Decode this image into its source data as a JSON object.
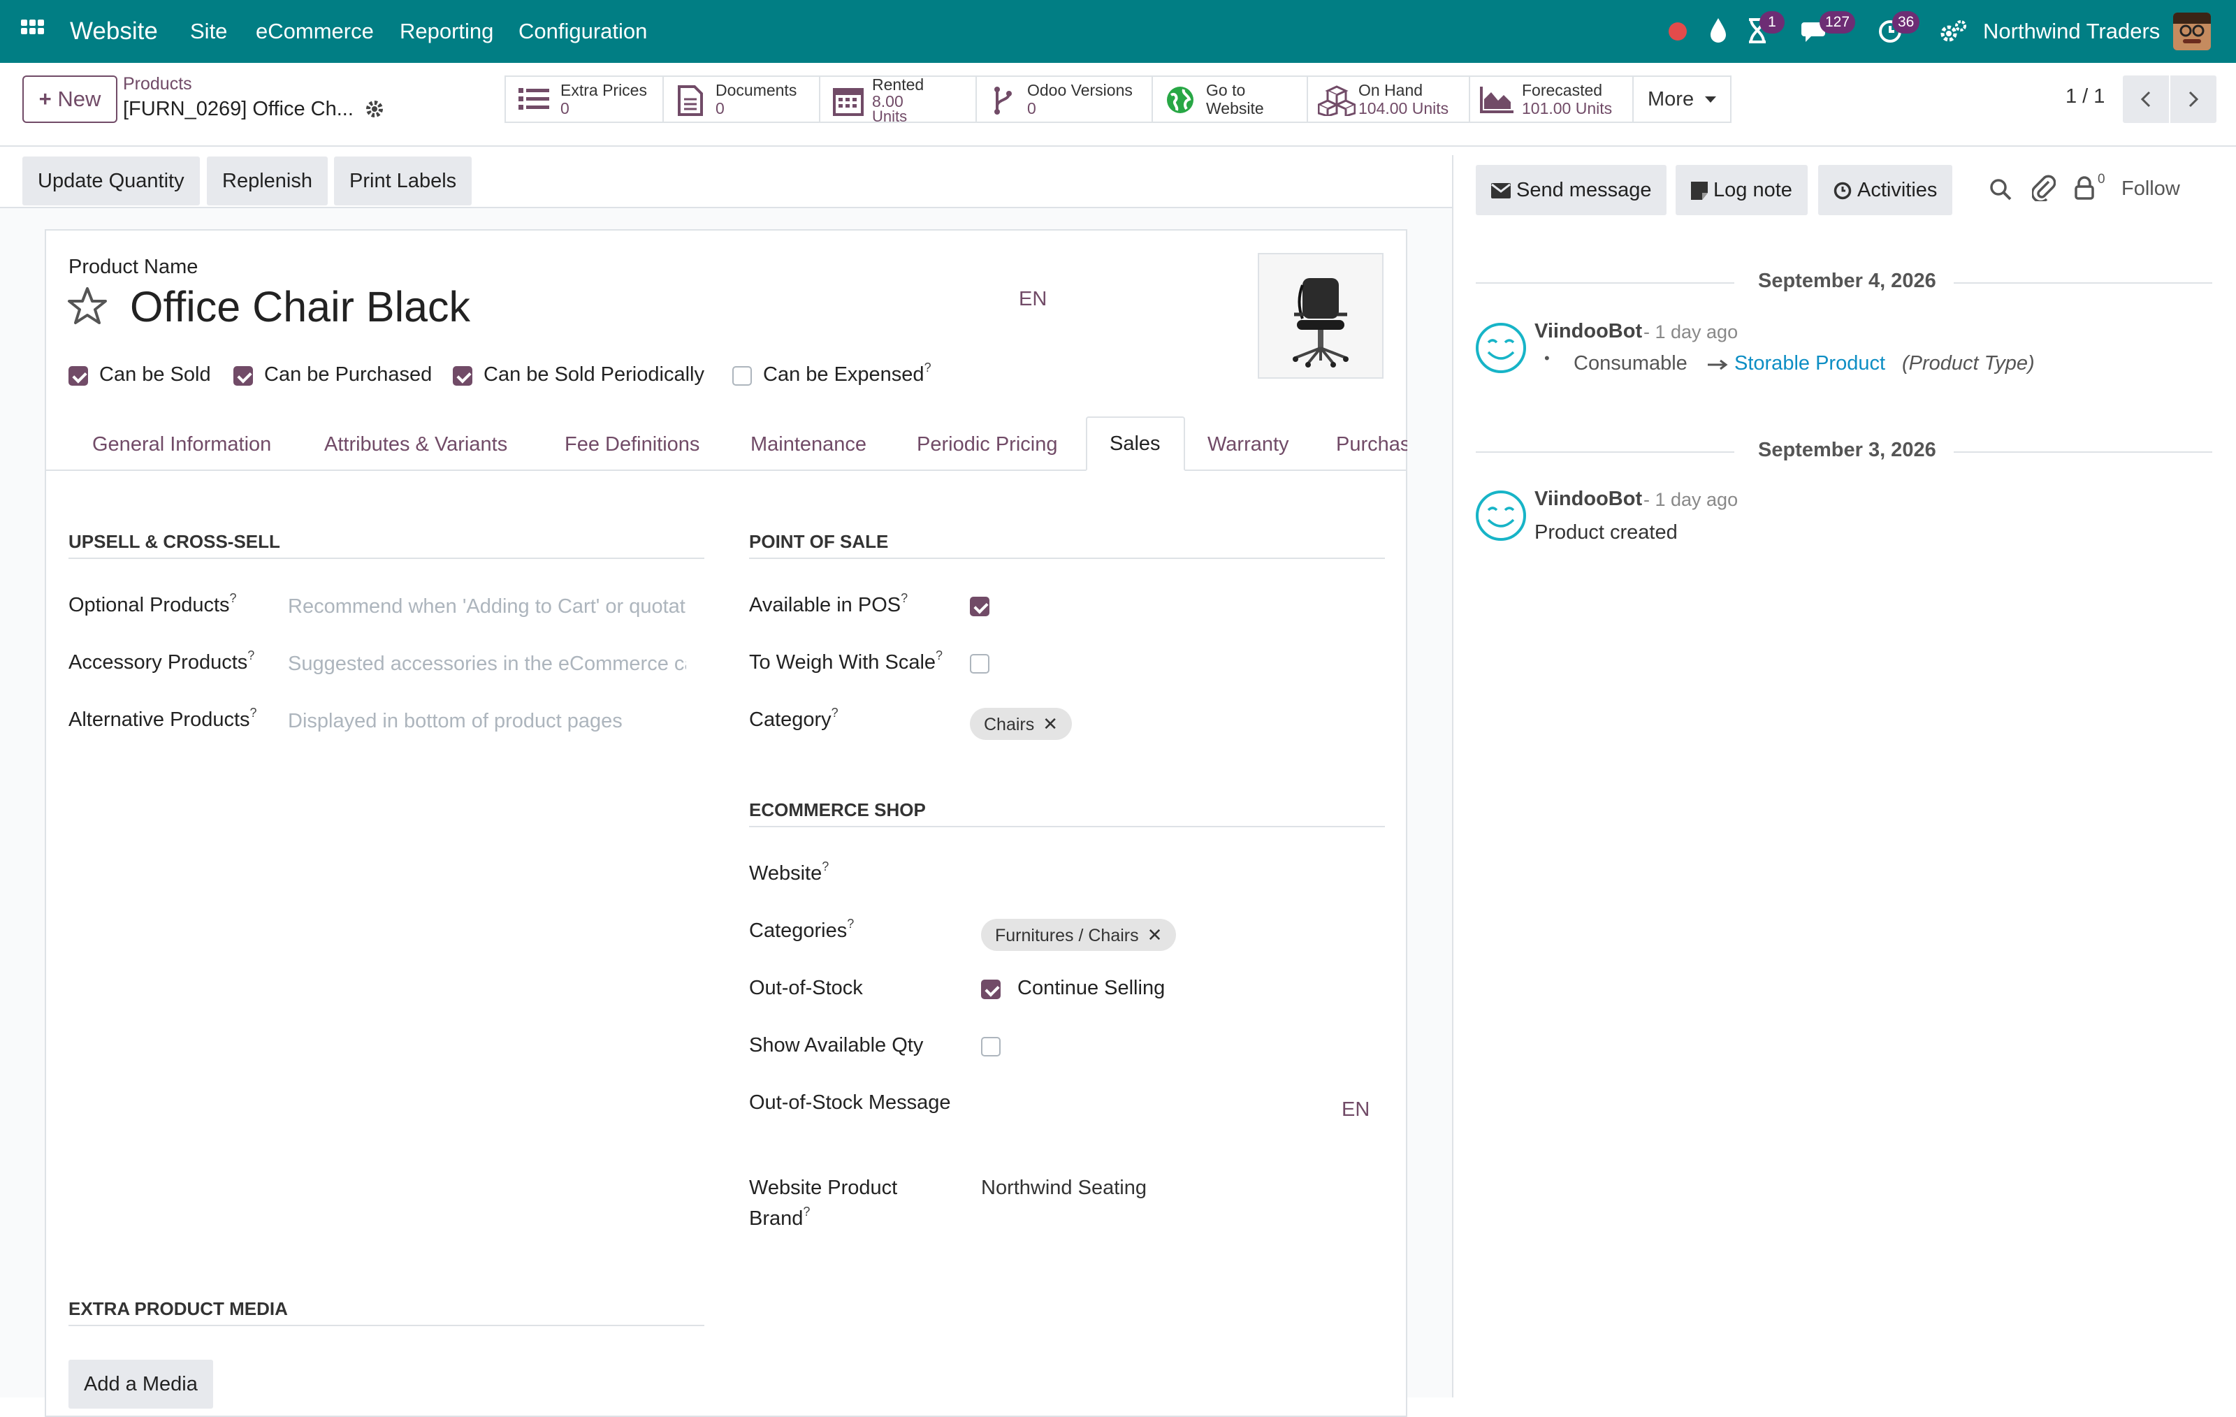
{
  "topbar": {
    "app_name": "Website",
    "menus": [
      "Site",
      "eCommerce",
      "Reporting",
      "Configuration"
    ],
    "activity_count": "1",
    "messages_count": "127",
    "clock_count": "36",
    "company": "Northwind Traders"
  },
  "control_panel": {
    "new_label": "New",
    "breadcrumb_parent": "Products",
    "breadcrumb_current": "[FURN_0269] Office Ch...",
    "pager": "1 / 1",
    "more_label": "More",
    "smart_buttons": [
      {
        "title": "Extra Prices",
        "value": "0"
      },
      {
        "title": "Documents",
        "value": "0"
      },
      {
        "title": "Rented",
        "value": "8.00",
        "value2": "Units"
      },
      {
        "title": "Odoo Versions",
        "value": "0"
      },
      {
        "title": "Go to",
        "value": "Website"
      },
      {
        "title": "On Hand",
        "value": "104.00 Units"
      },
      {
        "title": "Forecasted",
        "value": "101.00 Units"
      }
    ]
  },
  "statusbar": {
    "buttons": [
      "Update Quantity",
      "Replenish",
      "Print Labels"
    ]
  },
  "product": {
    "name_label": "Product Name",
    "name": "Office Chair Black",
    "lang": "EN",
    "flags": [
      {
        "label": "Can be Sold",
        "checked": true
      },
      {
        "label": "Can be Purchased",
        "checked": true
      },
      {
        "label": "Can be Sold Periodically",
        "checked": true
      },
      {
        "label": "Can be Expensed",
        "checked": false,
        "help": "?"
      }
    ]
  },
  "tabs": [
    "General Information",
    "Attributes & Variants",
    "Fee Definitions",
    "Maintenance",
    "Periodic Pricing",
    "Sales",
    "Warranty",
    "Purchas"
  ],
  "sales": {
    "upsell": {
      "title": "UPSELL & CROSS-SELL",
      "fields": [
        {
          "label": "Optional Products",
          "placeholder": "Recommend when 'Adding to Cart' or quotation"
        },
        {
          "label": "Accessory Products",
          "placeholder": "Suggested accessories in the eCommerce cart"
        },
        {
          "label": "Alternative Products",
          "placeholder": "Displayed in bottom of product pages"
        }
      ]
    },
    "pos": {
      "title": "POINT OF SALE",
      "available_label": "Available in POS",
      "available": true,
      "weigh_label": "To Weigh With Scale",
      "weigh": false,
      "category_label": "Category",
      "category_tag": "Chairs"
    },
    "ecommerce": {
      "title": "ECOMMERCE SHOP",
      "website_label": "Website",
      "categories_label": "Categories",
      "categories_tag": "Furnitures / Chairs",
      "oos_label": "Out-of-Stock",
      "continue_label": "Continue Selling",
      "continue": true,
      "show_qty_label": "Show Available Qty",
      "show_qty": false,
      "oos_msg_label": "Out-of-Stock Message",
      "oos_msg_lang": "EN",
      "brand_label_1": "Website Product",
      "brand_label_2": "Brand",
      "brand_value": "Northwind Seating"
    },
    "media": {
      "title": "EXTRA PRODUCT MEDIA",
      "add_label": "Add a Media"
    },
    "help_mark": "?"
  },
  "chatter": {
    "send_label": "Send message",
    "log_label": "Log note",
    "activities_label": "Activities",
    "followers_count": "0",
    "follow_label": "Follow",
    "groups": [
      {
        "date": "September 4, 2026",
        "author": "ViindooBot",
        "time": "- 1 day ago",
        "old_value": "Consumable",
        "new_value": "Storable Product",
        "field": "(Product Type)"
      },
      {
        "date": "September 3, 2026",
        "author": "ViindooBot",
        "time": "- 1 day ago",
        "body": "Product created"
      }
    ]
  },
  "colors": {
    "brand": "#017e84",
    "accent": "#714b67",
    "link": "#0d8ec4"
  }
}
